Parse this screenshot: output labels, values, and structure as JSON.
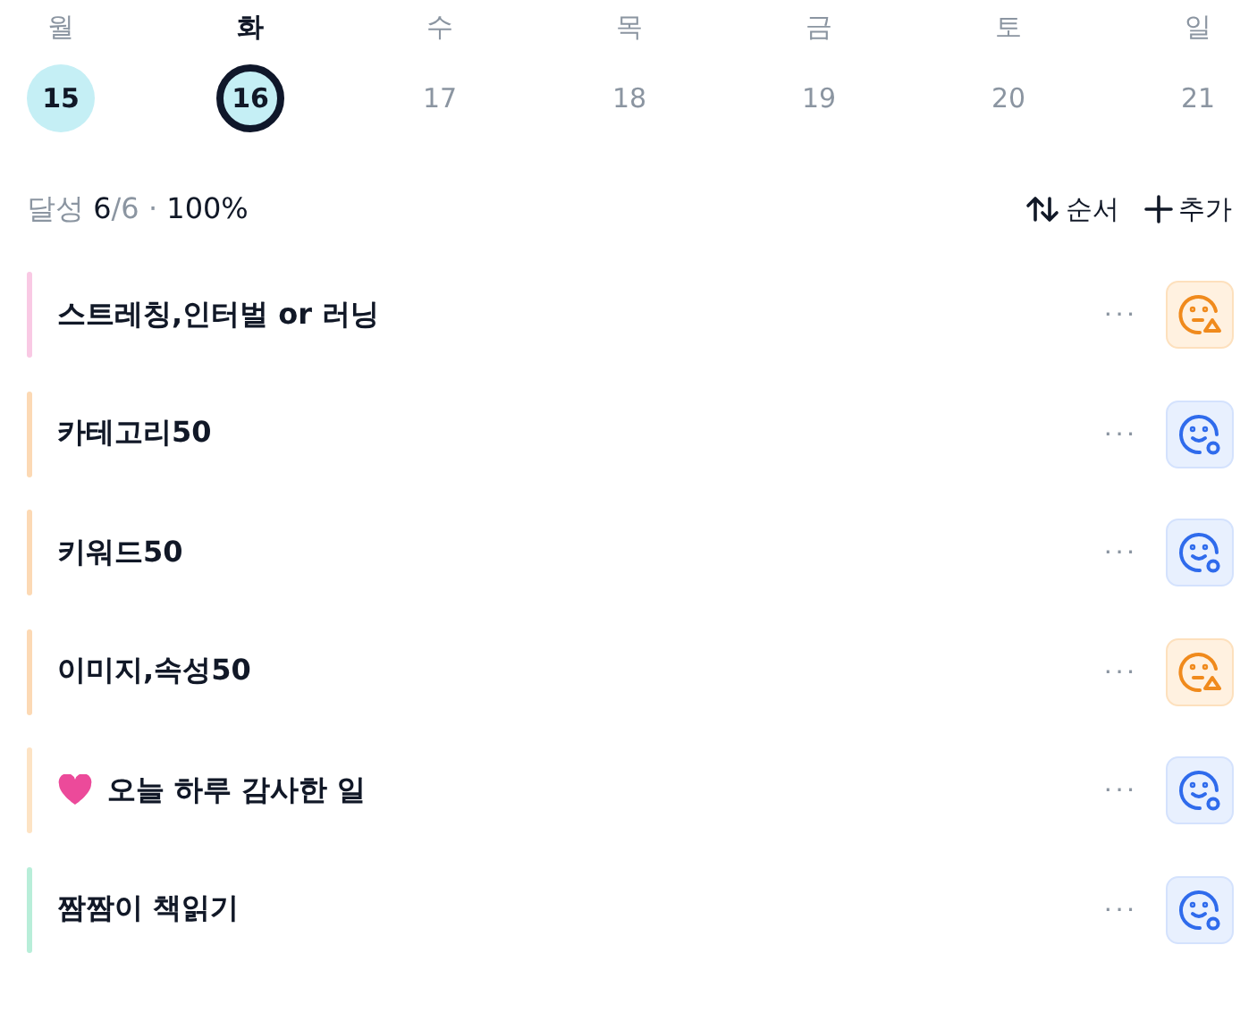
{
  "week": [
    {
      "weekday": "월",
      "date": "15",
      "done": true,
      "selected": false
    },
    {
      "weekday": "화",
      "date": "16",
      "done": true,
      "selected": true
    },
    {
      "weekday": "수",
      "date": "17",
      "done": false,
      "selected": false
    },
    {
      "weekday": "목",
      "date": "18",
      "done": false,
      "selected": false
    },
    {
      "weekday": "금",
      "date": "19",
      "done": false,
      "selected": false
    },
    {
      "weekday": "토",
      "date": "20",
      "done": false,
      "selected": false
    },
    {
      "weekday": "일",
      "date": "21",
      "done": false,
      "selected": false
    }
  ],
  "summary": {
    "label": "달성",
    "done": "6",
    "total": "/6",
    "separator": "·",
    "percent": "100%"
  },
  "actions": [
    {
      "kind": "sort",
      "label": "순서"
    },
    {
      "kind": "add",
      "label": "추가"
    }
  ],
  "habits": [
    {
      "title": "스트레칭,인터벌 or 러닝",
      "color": "#f9c9e4",
      "kind": "warning",
      "more": "···",
      "heart": false
    },
    {
      "title": "카테고리50",
      "color": "#fcd9b4",
      "kind": "good",
      "more": "···",
      "heart": false
    },
    {
      "title": "키워드50",
      "color": "#fcd9b4",
      "kind": "good",
      "more": "···",
      "heart": false
    },
    {
      "title": "이미지,속성50",
      "color": "#fcd9b4",
      "kind": "warning",
      "more": "···",
      "heart": false
    },
    {
      "title": "오늘 하루 감사한 일",
      "color": "#fde3c4",
      "kind": "good",
      "more": "···",
      "heart": true
    },
    {
      "title": "짬짬이 책읽기",
      "color": "#b8eed9",
      "kind": "good",
      "more": "···",
      "heart": false
    }
  ]
}
